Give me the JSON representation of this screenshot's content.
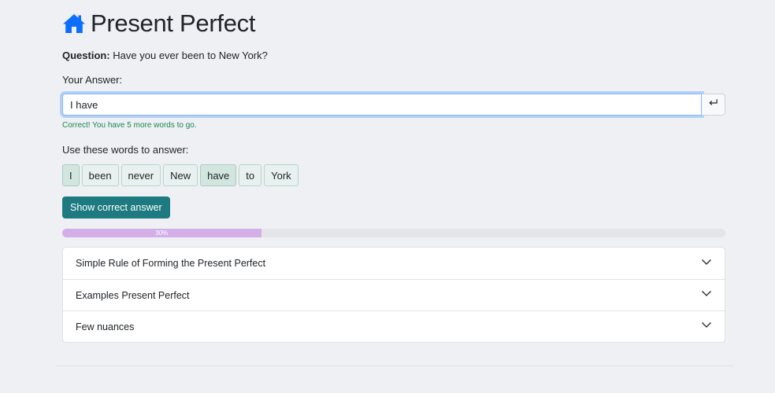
{
  "header": {
    "title": "Present Perfect",
    "icon": "home-icon",
    "icon_color": "#0d6efd"
  },
  "question": {
    "label": "Question:",
    "text": "Have you ever been to New York?"
  },
  "answer": {
    "label": "Your Answer:",
    "value": "I have ",
    "submit_icon": "enter-icon",
    "feedback": "Correct! You have 5 more words to go."
  },
  "words": {
    "label": "Use these words to answer:",
    "items": [
      {
        "text": "I",
        "used": true
      },
      {
        "text": "been",
        "used": false
      },
      {
        "text": "never",
        "used": false
      },
      {
        "text": "New",
        "used": false
      },
      {
        "text": "have",
        "used": true
      },
      {
        "text": "to",
        "used": false
      },
      {
        "text": "York",
        "used": false
      }
    ]
  },
  "show_answer_label": "Show correct answer",
  "progress": {
    "value": 30,
    "label": "30%",
    "color": "#d4aee8"
  },
  "accordion": [
    {
      "label": "Simple Rule of Forming the Present Perfect"
    },
    {
      "label": "Examples Present Perfect"
    },
    {
      "label": "Few nuances"
    }
  ],
  "colors": {
    "primary_button": "#1d7a80",
    "success_text": "#198754"
  }
}
